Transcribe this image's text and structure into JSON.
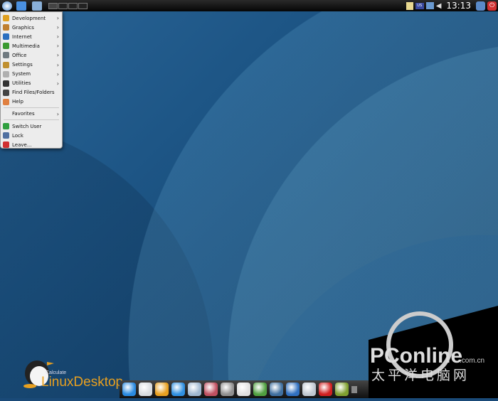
{
  "topbar": {
    "clock": "13:13",
    "icons": [
      "app-menu-icon",
      "home-folder-icon",
      "network-computer-icon",
      "workspace-1",
      "workspace-2",
      "workspace-3",
      "workspace-4"
    ],
    "tray": [
      "clipboard-icon",
      "keyboard-layout-icon",
      "network-icon",
      "volume-icon",
      "screen-lock-icon",
      "power-icon"
    ],
    "keyboard_layout": "US"
  },
  "menu": {
    "items": [
      {
        "label": "Development",
        "icon": "development-icon",
        "color": "#e0a020",
        "submenu": true
      },
      {
        "label": "Graphics",
        "icon": "graphics-icon",
        "color": "#c08030",
        "submenu": true
      },
      {
        "label": "Internet",
        "icon": "internet-icon",
        "color": "#2a6fc0",
        "submenu": true
      },
      {
        "label": "Multimedia",
        "icon": "multimedia-icon",
        "color": "#3a9a30",
        "submenu": true
      },
      {
        "label": "Office",
        "icon": "office-icon",
        "color": "#707a80",
        "submenu": true
      },
      {
        "label": "Settings",
        "icon": "settings-icon",
        "color": "#c09030",
        "submenu": true
      },
      {
        "label": "System",
        "icon": "system-icon",
        "color": "#b0b0b0",
        "submenu": true
      },
      {
        "label": "Utilities",
        "icon": "utilities-icon",
        "color": "#333333",
        "submenu": true
      },
      {
        "label": "Find Files/Folders",
        "icon": "binoculars-icon",
        "color": "#444444",
        "submenu": false
      },
      {
        "label": "Help",
        "icon": "help-icon",
        "color": "#e08040",
        "submenu": false
      }
    ],
    "favorites": "Favorites",
    "session": [
      {
        "label": "Switch User",
        "icon": "switch-user-icon",
        "color": "#30a040"
      },
      {
        "label": "Lock",
        "icon": "lock-icon",
        "color": "#5070a0"
      },
      {
        "label": "Leave...",
        "icon": "leave-icon",
        "color": "#d03030"
      }
    ]
  },
  "logo": {
    "small": "Calculate",
    "big": "LinuxDesktop"
  },
  "dock": [
    {
      "name": "network-globe-icon",
      "color": "#2a8ae0"
    },
    {
      "name": "mail-icon",
      "color": "#d8dce0"
    },
    {
      "name": "chat-icon",
      "color": "#e8a020"
    },
    {
      "name": "messenger-icon",
      "color": "#3090e0"
    },
    {
      "name": "document-viewer-icon",
      "color": "#a0b8d0"
    },
    {
      "name": "presentation-icon",
      "color": "#c05060"
    },
    {
      "name": "calculator-icon",
      "color": "#909090"
    },
    {
      "name": "text-editor-icon",
      "color": "#e0e0e0"
    },
    {
      "name": "image-viewer-icon",
      "color": "#50a040"
    },
    {
      "name": "media-sphere-icon",
      "color": "#4070a0"
    },
    {
      "name": "browser-icon",
      "color": "#3070c0"
    },
    {
      "name": "video-player-icon",
      "color": "#c0c8d0"
    },
    {
      "name": "burner-icon",
      "color": "#d02020"
    },
    {
      "name": "archive-icon",
      "color": "#80a030"
    }
  ],
  "watermark": {
    "brand": "PConline",
    "domain": ".com.cn",
    "chinese": "太平洋电脑网"
  }
}
